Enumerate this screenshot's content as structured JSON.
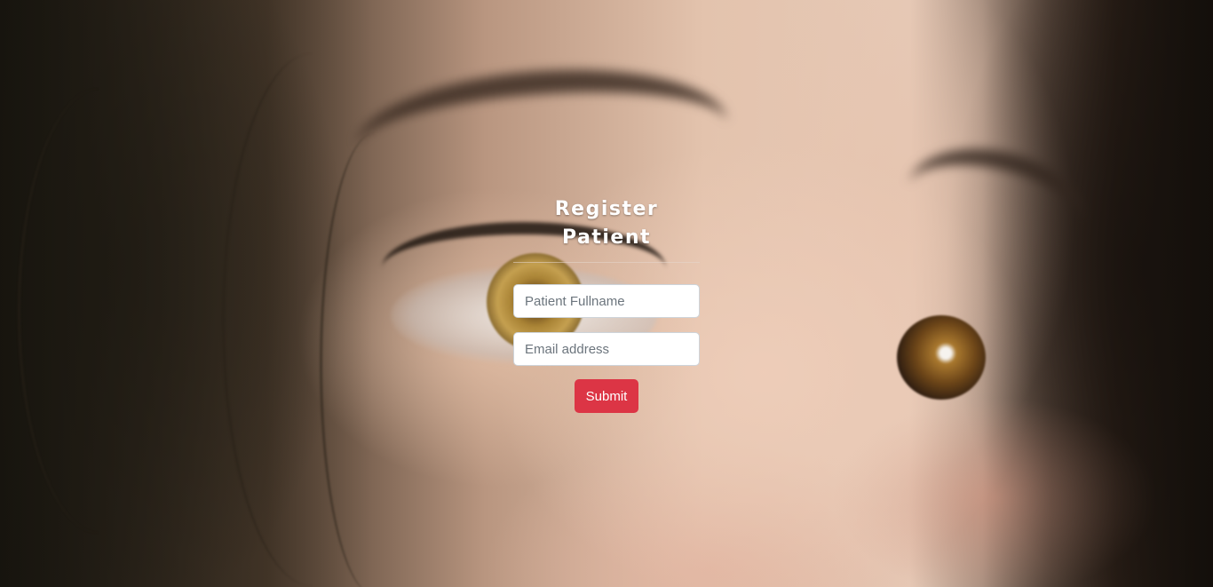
{
  "form": {
    "title": "Register Patient",
    "fullname_placeholder": "Patient Fullname",
    "fullname_value": "",
    "email_placeholder": "Email address",
    "email_value": "",
    "submit_label": "Submit"
  },
  "colors": {
    "submit_button": "#dc3545",
    "title_text": "#ffffff"
  }
}
